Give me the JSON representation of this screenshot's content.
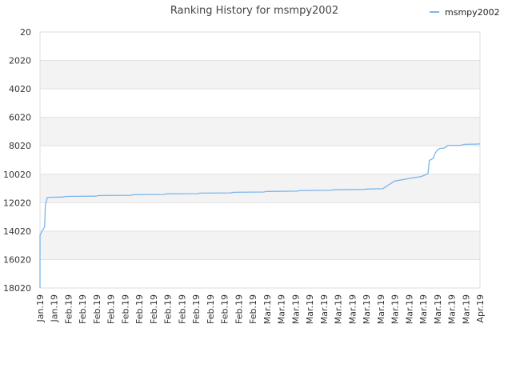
{
  "chart_data": {
    "type": "line",
    "title": "Ranking History for msmpy2002",
    "y_inverted": true,
    "ylim": [
      20,
      18020
    ],
    "y_ticks": [
      "20",
      "2020",
      "4020",
      "6020",
      "8020",
      "10020",
      "12020",
      "14020",
      "16020",
      "18020"
    ],
    "x_tick_labels": [
      "Jan.19",
      "Jan.19",
      "Feb.19",
      "Feb.19",
      "Feb.19",
      "Feb.19",
      "Feb.19",
      "Feb.19",
      "Feb.19",
      "Feb.19",
      "Feb.19",
      "Feb.19",
      "Feb.19",
      "Feb.19",
      "Feb.19",
      "Feb.19",
      "Mar.19",
      "Mar.19",
      "Mar.19",
      "Mar.19",
      "Mar.19",
      "Mar.19",
      "Mar.19",
      "Mar.19",
      "Mar.19",
      "Mar.19",
      "Mar.19",
      "Mar.19",
      "Mar.19",
      "Mar.19",
      "Mar.19",
      "Apr.19"
    ],
    "grid": true,
    "alternating_bands": true,
    "legend_position": "top-right",
    "series": [
      {
        "name": "msmpy2002",
        "color": "#7cb5ec",
        "points": [
          [
            0.0,
            18020
          ],
          [
            0.0,
            14300
          ],
          [
            0.35,
            13700
          ],
          [
            0.4,
            12200
          ],
          [
            0.55,
            11650
          ],
          [
            1.8,
            11620
          ],
          [
            1.9,
            11580
          ],
          [
            4.2,
            11560
          ],
          [
            4.4,
            11520
          ],
          [
            6.8,
            11500
          ],
          [
            7.0,
            11460
          ],
          [
            9.3,
            11440
          ],
          [
            9.5,
            11400
          ],
          [
            11.8,
            11390
          ],
          [
            12.0,
            11350
          ],
          [
            14.3,
            11330
          ],
          [
            14.5,
            11290
          ],
          [
            16.8,
            11270
          ],
          [
            17.0,
            11230
          ],
          [
            19.3,
            11210
          ],
          [
            19.5,
            11170
          ],
          [
            21.8,
            11150
          ],
          [
            22.0,
            11110
          ],
          [
            24.3,
            11090
          ],
          [
            24.5,
            11060
          ],
          [
            25.7,
            11040
          ],
          [
            26.6,
            10500
          ],
          [
            27.8,
            10300
          ],
          [
            28.6,
            10180
          ],
          [
            29.1,
            9980
          ],
          [
            29.2,
            9050
          ],
          [
            29.5,
            8900
          ],
          [
            29.6,
            8600
          ],
          [
            29.8,
            8320
          ],
          [
            30.0,
            8200
          ],
          [
            30.3,
            8190
          ],
          [
            30.6,
            8000
          ],
          [
            31.6,
            7980
          ],
          [
            31.8,
            7920
          ],
          [
            32.7,
            7900
          ],
          [
            33.0,
            7890
          ]
        ]
      }
    ]
  }
}
